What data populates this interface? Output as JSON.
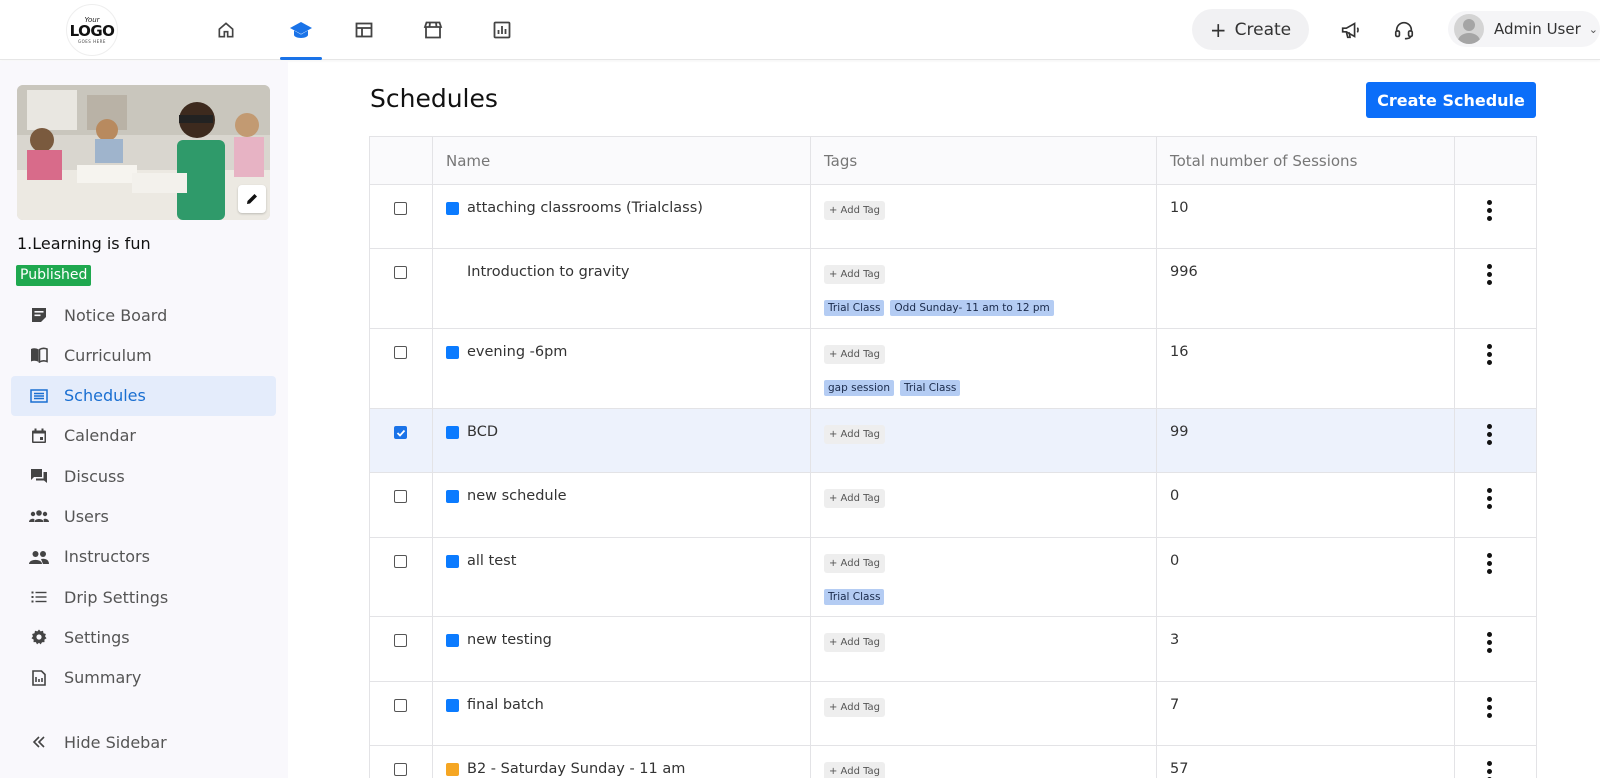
{
  "header": {
    "logo": {
      "line1": "Your",
      "line2": "LOGO",
      "line3": "GOES HERE"
    },
    "nav": [
      {
        "icon": "home-icon"
      },
      {
        "icon": "graduation-cap-icon",
        "active": true
      },
      {
        "icon": "dashboard-layout-icon"
      },
      {
        "icon": "store-icon"
      },
      {
        "icon": "reports-chart-icon"
      }
    ],
    "create_label": "Create",
    "user_name": "Admin User"
  },
  "sidebar": {
    "course_title": "1.Learning is fun",
    "status": "Published",
    "items": [
      {
        "label": "Notice Board",
        "icon": "notice-board-icon"
      },
      {
        "label": "Curriculum",
        "icon": "book-open-icon"
      },
      {
        "label": "Schedules",
        "icon": "schedule-list-icon",
        "active": true
      },
      {
        "label": "Calendar",
        "icon": "calendar-icon"
      },
      {
        "label": "Discuss",
        "icon": "chat-icon"
      },
      {
        "label": "Users",
        "icon": "users-icon"
      },
      {
        "label": "Instructors",
        "icon": "instructors-icon"
      },
      {
        "label": "Drip Settings",
        "icon": "list-icon"
      },
      {
        "label": "Settings",
        "icon": "gear-icon"
      },
      {
        "label": "Summary",
        "icon": "summary-icon"
      }
    ],
    "hide_label": "Hide Sidebar"
  },
  "main": {
    "title": "Schedules",
    "create_schedule_label": "Create Schedule",
    "columns": [
      "Name",
      "Tags",
      "Total number of Sessions"
    ],
    "add_tag_label": "+ Add Tag",
    "rows": [
      {
        "name": "attaching classrooms (Trialclass)",
        "color": "#0b7bff",
        "tags": [],
        "sessions": "10",
        "checked": false
      },
      {
        "name": "Introduction to gravity",
        "color": "",
        "tags": [
          "Trial Class",
          "Odd Sunday- 11 am to 12 pm"
        ],
        "sessions": "996",
        "checked": false
      },
      {
        "name": "evening -6pm",
        "color": "#0b7bff",
        "tags": [
          "gap session",
          "Trial Class"
        ],
        "sessions": "16",
        "checked": false
      },
      {
        "name": "BCD",
        "color": "#0b7bff",
        "tags": [],
        "sessions": "99",
        "checked": true
      },
      {
        "name": "new schedule",
        "color": "#0b7bff",
        "tags": [],
        "sessions": "0",
        "checked": false
      },
      {
        "name": "all test",
        "color": "#0b7bff",
        "tags": [
          "Trial Class"
        ],
        "sessions": "0",
        "checked": false
      },
      {
        "name": "new testing",
        "color": "#0b7bff",
        "tags": [],
        "sessions": "3",
        "checked": false
      },
      {
        "name": "final batch",
        "color": "#0b7bff",
        "tags": [],
        "sessions": "7",
        "checked": false
      },
      {
        "name": "B2 - Saturday Sunday - 11 am",
        "color": "#f5a623",
        "tags": [],
        "sessions": "57",
        "checked": false
      }
    ]
  },
  "colors": {
    "accent": "#0b6ef9",
    "published": "#1fa84f",
    "tag_bg": "#b4ccf3"
  }
}
